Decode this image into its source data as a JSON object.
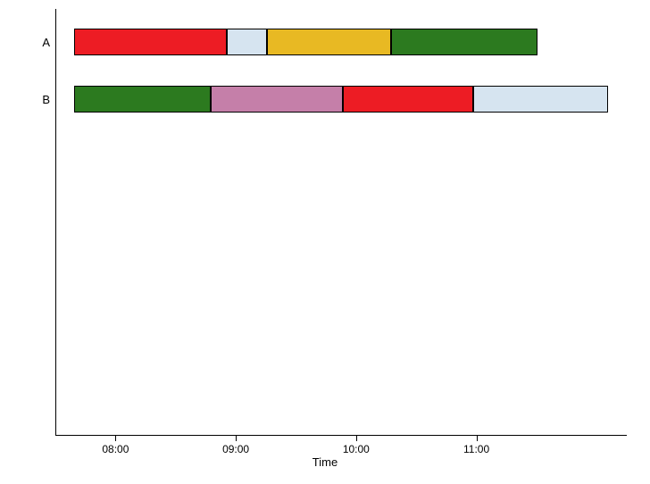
{
  "chart_data": {
    "type": "bar",
    "orientation": "horizontal-timeline",
    "xlabel": "Time",
    "x_ticks": [
      "08:00",
      "09:00",
      "10:00",
      "11:00"
    ],
    "x_range_minutes": [
      450,
      735
    ],
    "categories": [
      "A",
      "B"
    ],
    "series": [
      {
        "name": "A",
        "segments": [
          {
            "start": "07:39",
            "end": "08:55",
            "color": "#ed1c24"
          },
          {
            "start": "08:55",
            "end": "09:15",
            "color": "#d6e4f0"
          },
          {
            "start": "09:15",
            "end": "10:17",
            "color": "#e8b923"
          },
          {
            "start": "10:17",
            "end": "11:30",
            "color": "#2c7a1f"
          }
        ]
      },
      {
        "name": "B",
        "segments": [
          {
            "start": "07:39",
            "end": "08:47",
            "color": "#2c7a1f"
          },
          {
            "start": "08:47",
            "end": "09:53",
            "color": "#c57fa9"
          },
          {
            "start": "09:53",
            "end": "10:58",
            "color": "#ed1c24"
          },
          {
            "start": "10:58",
            "end": "12:05",
            "color": "#d6e4f0"
          }
        ]
      }
    ]
  },
  "layout": {
    "row_tops": [
      22,
      86
    ],
    "label_tops": [
      30,
      94
    ]
  }
}
